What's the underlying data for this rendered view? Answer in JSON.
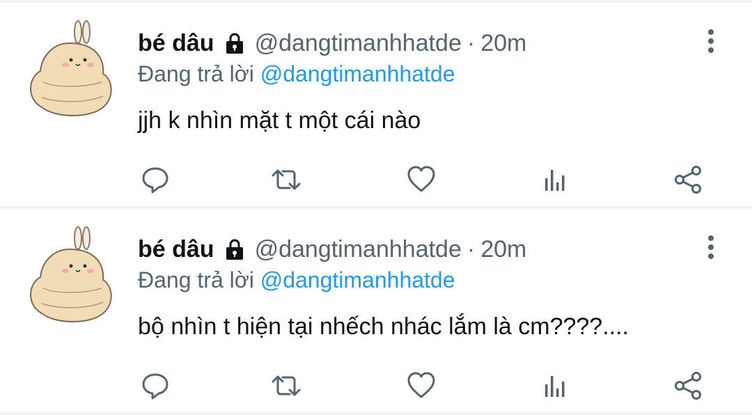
{
  "tweets": [
    {
      "display_name": "bé dâu",
      "handle": "@dangtimanhhatde",
      "separator": "·",
      "time": "20m",
      "reply_prefix": "Đang trả lời",
      "reply_to": "@dangtimanhhatde",
      "text": "jjh k nhìn mặt t một cái nào"
    },
    {
      "display_name": "bé dâu",
      "handle": "@dangtimanhhatde",
      "separator": "·",
      "time": "20m",
      "reply_prefix": "Đang trả lời",
      "reply_to": "@dangtimanhhatde",
      "text": "bộ nhìn t hiện tại nhếch nhác lắm là cm????...."
    }
  ],
  "icons": {
    "protected": "lock-icon",
    "more": "more-vertical-icon",
    "reply": "reply-icon",
    "retweet": "retweet-icon",
    "like": "heart-icon",
    "analytics": "analytics-icon",
    "share": "share-icon",
    "avatar": "bunny-avatar"
  },
  "colors": {
    "text": "#0f1419",
    "secondary": "#536471",
    "accent": "#1d9bf0",
    "divider": "#eff3f4"
  }
}
